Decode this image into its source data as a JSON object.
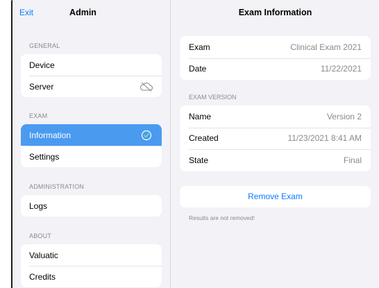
{
  "sidebar": {
    "exit_label": "Exit",
    "title": "Admin",
    "sections": [
      {
        "label": "GENERAL",
        "items": [
          {
            "label": "Device"
          },
          {
            "label": "Server",
            "icon": "cloud-off-icon"
          }
        ]
      },
      {
        "label": "EXAM",
        "items": [
          {
            "label": "Information",
            "icon": "checkmark-circle-icon",
            "selected": true
          },
          {
            "label": "Settings"
          }
        ]
      },
      {
        "label": "ADMINISTRATION",
        "items": [
          {
            "label": "Logs"
          }
        ]
      },
      {
        "label": "ABOUT",
        "items": [
          {
            "label": "Valuatic"
          },
          {
            "label": "Credits"
          }
        ]
      }
    ]
  },
  "detail": {
    "title": "Exam Information",
    "exam": {
      "exam_key": "Exam",
      "exam_value": "Clinical Exam 2021",
      "date_key": "Date",
      "date_value": "11/22/2021"
    },
    "version_section": "EXAM VERSION",
    "version": {
      "name_key": "Name",
      "name_value": "Version 2",
      "created_key": "Created",
      "created_value": "11/23/2021 8:41 AM",
      "state_key": "State",
      "state_value": "Final"
    },
    "remove_label": "Remove Exam",
    "footnote": "Results are not removed!"
  },
  "colors": {
    "accent": "#0a7aff",
    "selected_row": "#4a9bf0",
    "background": "#f2f2f7"
  }
}
